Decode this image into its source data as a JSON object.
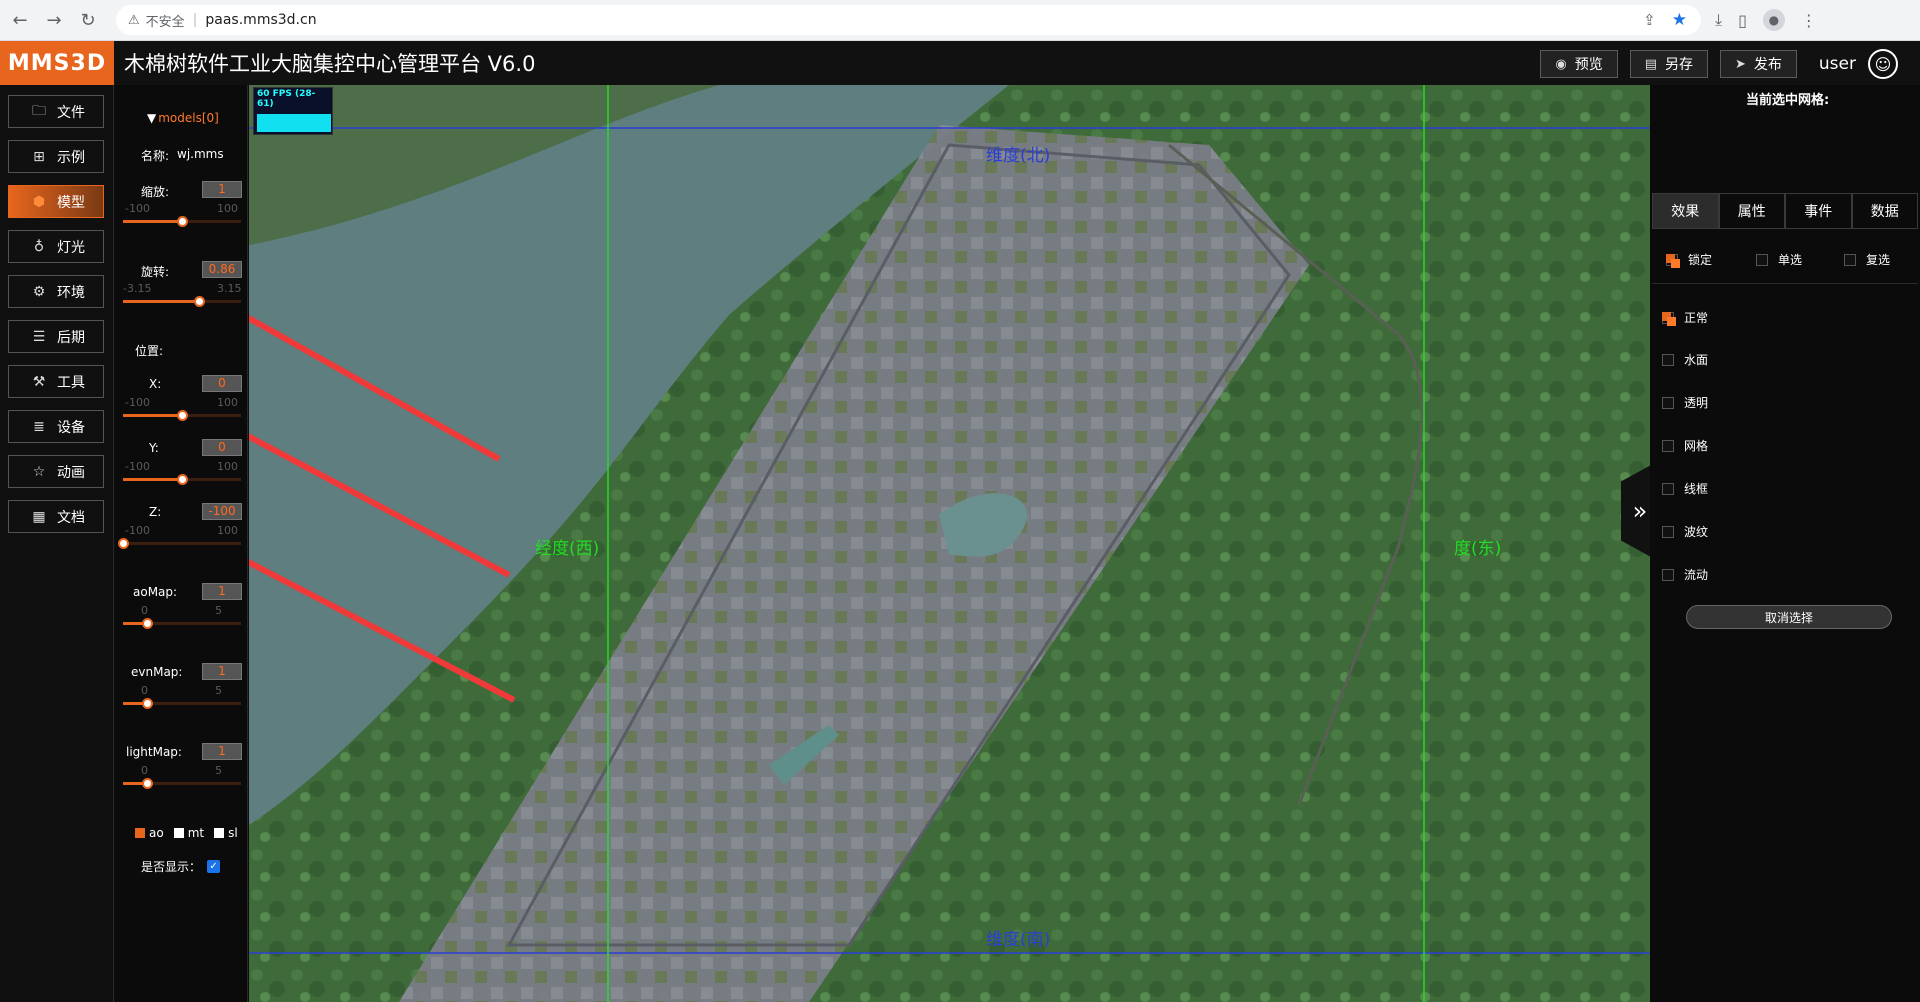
{
  "browser": {
    "insecure_label": "不安全",
    "url": "paas.mms3d.cn"
  },
  "header": {
    "logo": "MMS3D",
    "title": "木棉树软件工业大脑集控中心管理平台 V6.0",
    "preview_label": "预览",
    "saveas_label": "另存",
    "publish_label": "发布",
    "user_name": "user"
  },
  "left_nav": {
    "items": [
      {
        "label": "文件",
        "icon": "folder-icon"
      },
      {
        "label": "示例",
        "icon": "grid-icon"
      },
      {
        "label": "模型",
        "icon": "cube-icon"
      },
      {
        "label": "灯光",
        "icon": "bulb-icon"
      },
      {
        "label": "环境",
        "icon": "gear-icon"
      },
      {
        "label": "后期",
        "icon": "layers-icon"
      },
      {
        "label": "工具",
        "icon": "wrench-icon"
      },
      {
        "label": "设备",
        "icon": "list-icon"
      },
      {
        "label": "动画",
        "icon": "star-icon"
      },
      {
        "label": "文档",
        "icon": "document-icon"
      }
    ],
    "active_index": 2
  },
  "model_panel": {
    "models_header": "models[0]",
    "name_label": "名称:",
    "name_value": "wj.mms",
    "scale": {
      "label": "缩放:",
      "value": "1",
      "min": "-100",
      "max": "100",
      "fraction": 0.5
    },
    "rotation": {
      "label": "旋转:",
      "value": "0.86",
      "min": "-3.15",
      "max": "3.15",
      "fraction": 0.64
    },
    "position_label": "位置:",
    "x": {
      "label": "X:",
      "value": "0",
      "min": "-100",
      "max": "100",
      "fraction": 0.5
    },
    "y": {
      "label": "Y:",
      "value": "0",
      "min": "-100",
      "max": "100",
      "fraction": 0.5
    },
    "z": {
      "label": "Z:",
      "value": "-100",
      "min": "-100",
      "max": "100",
      "fraction": 0.0
    },
    "aomap": {
      "label": "aoMap:",
      "value": "1",
      "min": "0",
      "max": "5",
      "fraction": 0.2
    },
    "envmap": {
      "label": "evnMap:",
      "value": "1",
      "min": "0",
      "max": "5",
      "fraction": 0.2
    },
    "lightmap": {
      "label": "lightMap:",
      "value": "1",
      "min": "0",
      "max": "5",
      "fraction": 0.2
    },
    "channels": {
      "ao": "ao",
      "mt": "mt",
      "sl": "sl"
    },
    "show_label": "是否显示：",
    "show_checked": true
  },
  "map": {
    "fps": "60 FPS (28-61)",
    "north": "维度(北)",
    "south": "维度(南)",
    "west": "经度(西)",
    "east": "度(东)",
    "colors": {
      "latitude_line": "#2a3fd6",
      "longitude_line": "#22dd22",
      "arrow": "#f03a3a"
    }
  },
  "right_panel": {
    "title": "当前选中网格:",
    "tabs": [
      "效果",
      "属性",
      "事件",
      "数据"
    ],
    "active_tab": 0,
    "select_modes": [
      {
        "label": "锁定",
        "checked": true
      },
      {
        "label": "单选",
        "checked": false
      },
      {
        "label": "复选",
        "checked": false
      }
    ],
    "effects": [
      {
        "label": "正常",
        "checked": true
      },
      {
        "label": "水面",
        "checked": false
      },
      {
        "label": "透明",
        "checked": false
      },
      {
        "label": "网格",
        "checked": false
      },
      {
        "label": "线框",
        "checked": false
      },
      {
        "label": "波纹",
        "checked": false
      },
      {
        "label": "流动",
        "checked": false
      }
    ],
    "cancel_label": "取消选择"
  },
  "colors": {
    "accent": "#e8651e",
    "background": "#0b0b0b"
  }
}
